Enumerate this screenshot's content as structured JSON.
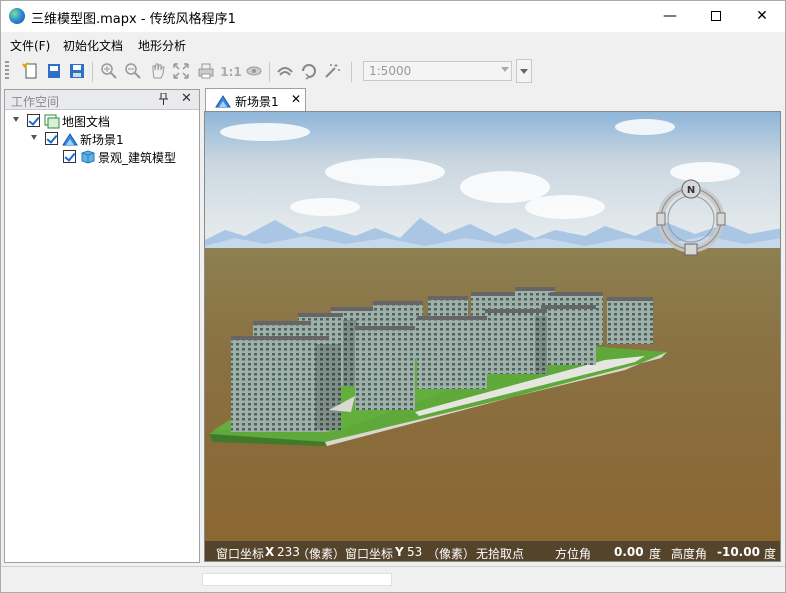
{
  "window": {
    "title": "三维模型图.mapx - 传统风格程序1",
    "controls": {
      "minimize": "—",
      "maximize": "",
      "close": "✕"
    }
  },
  "menu": {
    "file": "文件(F)",
    "init_doc": "初始化文档",
    "terrain": "地形分析"
  },
  "toolbar": {
    "scale_value": "1:5000",
    "one_to_one": "1:1",
    "icons": [
      "new-icon",
      "open-icon",
      "save-icon",
      "zoom-in-icon",
      "zoom-out-icon",
      "pan-icon",
      "full-extent-icon",
      "print-icon",
      "one-to-one-icon",
      "eye-icon",
      "fly-icon",
      "rotate-icon",
      "magic-wand-icon"
    ]
  },
  "workspace": {
    "title": "工作空间",
    "pin": "📌",
    "close": "✕",
    "tree": {
      "root": "地图文档",
      "scene": "新场景1",
      "layer": "景观_建筑模型"
    }
  },
  "doc_tab": {
    "label": "新场景1",
    "close": "✕"
  },
  "scene": {
    "compass_letter": "N",
    "colors": {
      "sky_top": "#8fb4d8",
      "ground": "#8a6a3a",
      "lawn": "#5fa83a",
      "building": "#8a9a94"
    }
  },
  "scene_status": {
    "win_x_label": "窗口坐标",
    "x_axis": "X",
    "x_value": "233",
    "x_unit": "（像素）",
    "win_y_label": "窗口坐标",
    "y_axis": "Y",
    "y_value": "53",
    "y_unit": "（像素）",
    "pick_status": "无拾取点",
    "azimuth_label": "方位角",
    "azimuth_value": "0.00",
    "azimuth_unit": "度",
    "elevation_label": "高度角",
    "elevation_value": "-10.00",
    "elevation_unit": "度"
  }
}
